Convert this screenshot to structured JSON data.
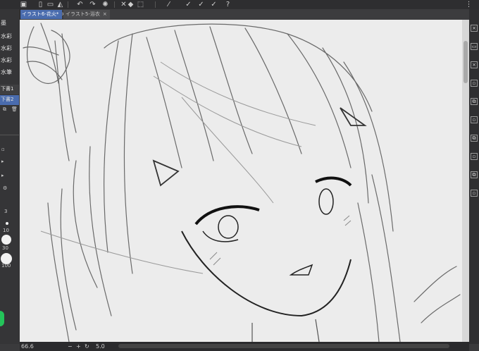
{
  "tabs": [
    {
      "label": "イラスト6-花火*",
      "active": true
    },
    {
      "label": "イラスト5-浴衣",
      "active": false
    }
  ],
  "left_panel": {
    "header": "墨",
    "brush_list": [
      "水彩",
      "水彩",
      "水彩",
      "水筆"
    ],
    "layers": [
      "下書1",
      "下書2"
    ],
    "size_labels": [
      "3",
      "10",
      "30",
      "100"
    ]
  },
  "status": {
    "zoom": "66.6",
    "angle": "5.0"
  },
  "colors": {
    "accent": "#4a6cae",
    "knob": "#24c45a"
  }
}
